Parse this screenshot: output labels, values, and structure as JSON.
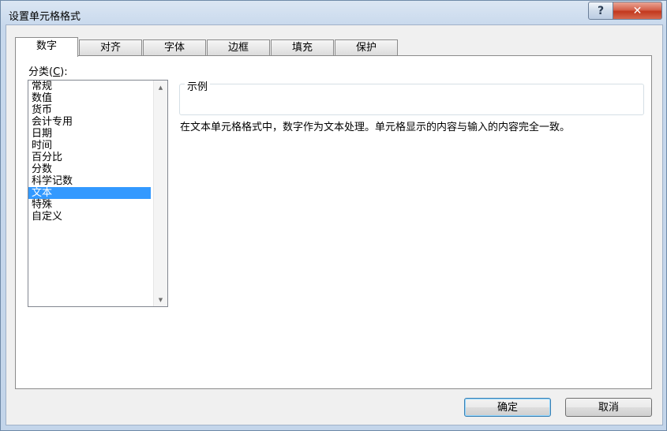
{
  "window": {
    "title": "设置单元格格式",
    "help_label": "?",
    "close_label": "✕"
  },
  "tabs": [
    {
      "label": "数字",
      "active": true
    },
    {
      "label": "对齐",
      "active": false
    },
    {
      "label": "字体",
      "active": false
    },
    {
      "label": "边框",
      "active": false
    },
    {
      "label": "填充",
      "active": false
    },
    {
      "label": "保护",
      "active": false
    }
  ],
  "category": {
    "label_prefix": "分类(",
    "label_accel": "C",
    "label_suffix": "):",
    "items": [
      "常规",
      "数值",
      "货币",
      "会计专用",
      "日期",
      "时间",
      "百分比",
      "分数",
      "科学记数",
      "文本",
      "特殊",
      "自定义"
    ],
    "selected": "文本"
  },
  "sample": {
    "legend": "示例",
    "value": ""
  },
  "description": "在文本单元格格式中，数字作为文本处理。单元格显示的内容与输入的内容完全一致。",
  "buttons": {
    "ok": "确定",
    "cancel": "取消"
  }
}
